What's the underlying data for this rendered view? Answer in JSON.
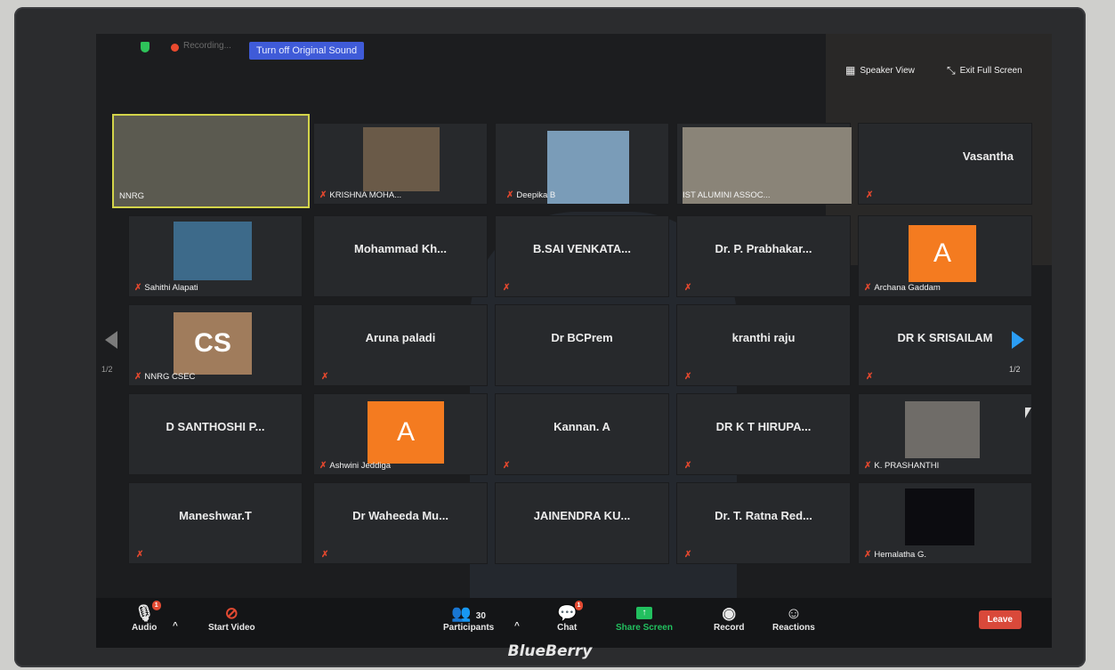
{
  "monitor": {
    "brand": "BlueBerry"
  },
  "topbar": {
    "recording_label": "Recording...",
    "original_sound_btn": "Turn off Original Sound",
    "speaker_view": "Speaker View",
    "exit_full_screen": "Exit Full Screen"
  },
  "tiles": {
    "nnrg": "NNRG",
    "krishna": "KRISHNA MOHA...",
    "deepika": "Deepika B",
    "ist": "IST ALUMINI ASSOC...",
    "vasantha": "Vasantha",
    "sahithi": "Sahithi Alapati",
    "mohammad": "Mohammad Kh...",
    "sai": "B.SAI VENKATA...",
    "prabhakar": "Dr. P. Prabhakar...",
    "archana_initial": "A",
    "archana": "Archana Gaddam",
    "csec_initials": "CS",
    "csec": "NNRG CSEC",
    "aruna": "Aruna paladi",
    "bcprem": "Dr BCPrem",
    "kranthi": "kranthi raju",
    "srisailam": "DR K SRISAILAM",
    "santhoshi": "D SANTHOSHI P...",
    "ashwini_initial": "A",
    "ashwini": "Ashwini Jeddiga",
    "kannan": "Kannan. A",
    "hirupa": "DR K T HIRUPA...",
    "prashanthi": "K. PRASHANTHI",
    "maneshwar": "Maneshwar.T",
    "waheeda": "Dr Waheeda Mu...",
    "jainendra": "JAINENDRA KU...",
    "ratna": "Dr. T. Ratna Red...",
    "hemalatha": "Hemalatha G."
  },
  "pagination": {
    "page_left": "1/2",
    "page_right": "1/2"
  },
  "toolbar": {
    "audio": "Audio",
    "start_video": "Start Video",
    "participants": "Participants",
    "participants_count": "30",
    "chat": "Chat",
    "share_screen": "Share Screen",
    "record": "Record",
    "reactions": "Reactions",
    "leave": "Leave",
    "audio_badge": "1",
    "chat_badge": "1"
  },
  "colors": {
    "accent_blue": "#3f5bd8",
    "active_speaker_border": "#d3d44a",
    "avatar_orange": "#f47b20",
    "avatar_tan": "#a07c5c",
    "leave_red": "#d9493a",
    "share_green": "#22c05f"
  }
}
